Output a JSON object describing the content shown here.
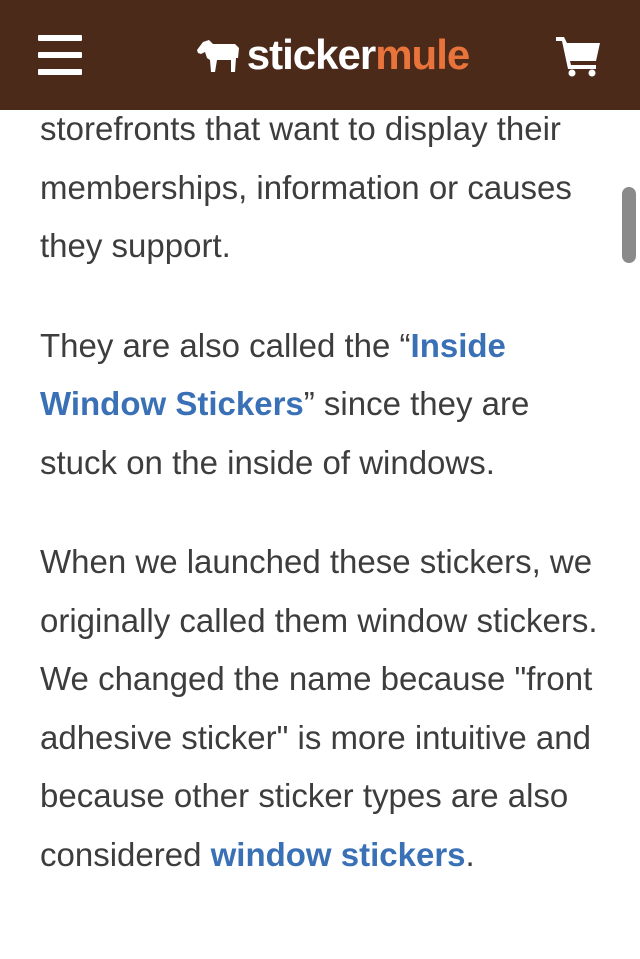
{
  "header": {
    "logo_part1": "sticker",
    "logo_part2": "mule",
    "colors": {
      "background": "#4b2a1a",
      "logo_accent": "#e8743b",
      "logo_main": "#ffffff"
    },
    "icons": [
      "menu-icon",
      "horse-icon",
      "cart-icon"
    ]
  },
  "article": {
    "p1": "storefronts that want to display their memberships, information or causes they support.",
    "p2_before": "They are also called the “",
    "p2_link": "Inside Window Stickers",
    "p2_after": "” since they are stuck on the inside of windows.",
    "p3_before": "When we launched these stickers, we originally called them window stickers. We changed the name because \"front adhesive sticker\" is more intuitive and because other sticker types are also considered ",
    "p3_link": "window stickers",
    "p3_after": ".",
    "colors": {
      "text": "#3d3d3d",
      "link": "#3a70b5"
    }
  }
}
